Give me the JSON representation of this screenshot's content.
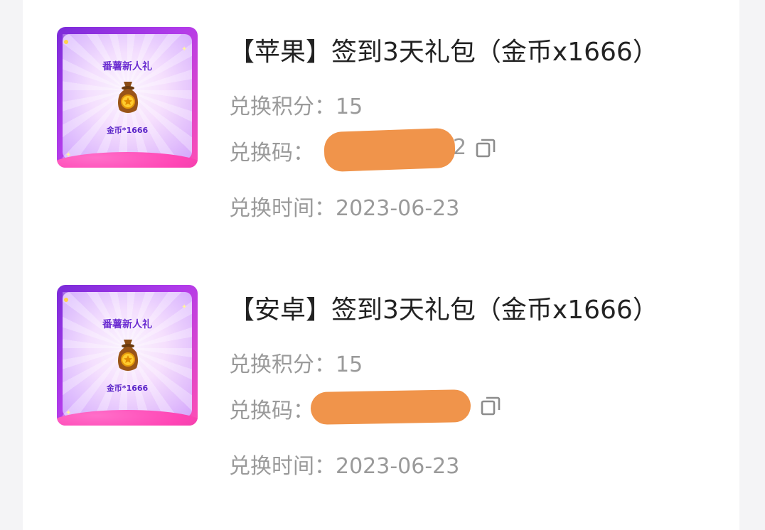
{
  "items": [
    {
      "name": "【苹果】签到3天礼包（金币x1666）",
      "points_label": "兑换积分：",
      "points": "15",
      "code_label": "兑换码：",
      "code_tail": "2",
      "time_label": "兑换时间：",
      "time": "2023-06-23",
      "thumb": {
        "title": "番薯新人礼",
        "caption": "金币*1666",
        "icon": "money-bag-icon"
      }
    },
    {
      "name": "【安卓】签到3天礼包（金币x1666）",
      "points_label": "兑换积分：",
      "points": "15",
      "code_label": "兑换码：",
      "code_tail": "",
      "time_label": "兑换时间：",
      "time": "2023-06-23",
      "thumb": {
        "title": "番薯新人礼",
        "caption": "金币*1666",
        "icon": "money-bag-icon"
      }
    }
  ],
  "colors": {
    "redaction": "#f0944b",
    "muted_text": "#9a9a9a",
    "title_text": "#222222"
  }
}
